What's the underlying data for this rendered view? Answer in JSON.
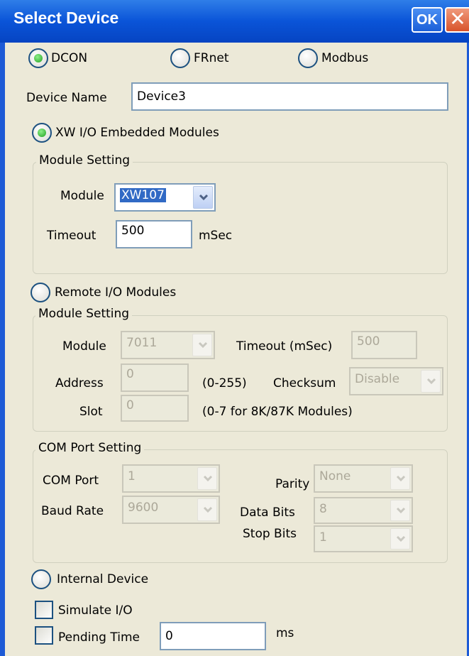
{
  "window": {
    "title": "Select Device",
    "ok_label": "OK",
    "close_glyph": "✕"
  },
  "protocol": {
    "dcon": "DCON",
    "frnet": "FRnet",
    "modbus": "Modbus",
    "selected": "DCON"
  },
  "device_name": {
    "label": "Device Name",
    "value": "Device3"
  },
  "xw": {
    "radio_label": "XW I/O Embedded Modules",
    "group_title": "Module Setting",
    "module_label": "Module",
    "module_value": "XW107",
    "timeout_label": "Timeout",
    "timeout_value": "500",
    "timeout_unit": "mSec"
  },
  "remote": {
    "radio_label": "Remote I/O Modules",
    "group_title": "Module Setting",
    "module_label": "Module",
    "module_value": "7011",
    "timeout_label": "Timeout (mSec)",
    "timeout_value": "500",
    "address_label": "Address",
    "address_value": "0",
    "address_range": "(0-255)",
    "checksum_label": "Checksum",
    "checksum_value": "Disable",
    "slot_label": "Slot",
    "slot_value": "0",
    "slot_range": "(0-7 for 8K/87K Modules)"
  },
  "com": {
    "group_title": "COM Port Setting",
    "port_label": "COM Port",
    "port_value": "1",
    "baud_label": "Baud Rate",
    "baud_value": "9600",
    "parity_label": "Parity",
    "parity_value": "None",
    "databits_label": "Data Bits",
    "databits_value": "8",
    "stopbits_label": "Stop Bits",
    "stopbits_value": "1"
  },
  "internal": {
    "radio_label": "Internal Device"
  },
  "simulate": {
    "label": "Simulate I/O",
    "checked": false
  },
  "pending": {
    "label": "Pending Time",
    "value": "0",
    "unit": "ms",
    "checked": false
  },
  "colors": {
    "titlebar": "#0a54d8",
    "dialog_bg": "#ece9d8",
    "radio_on": "#21a121"
  }
}
